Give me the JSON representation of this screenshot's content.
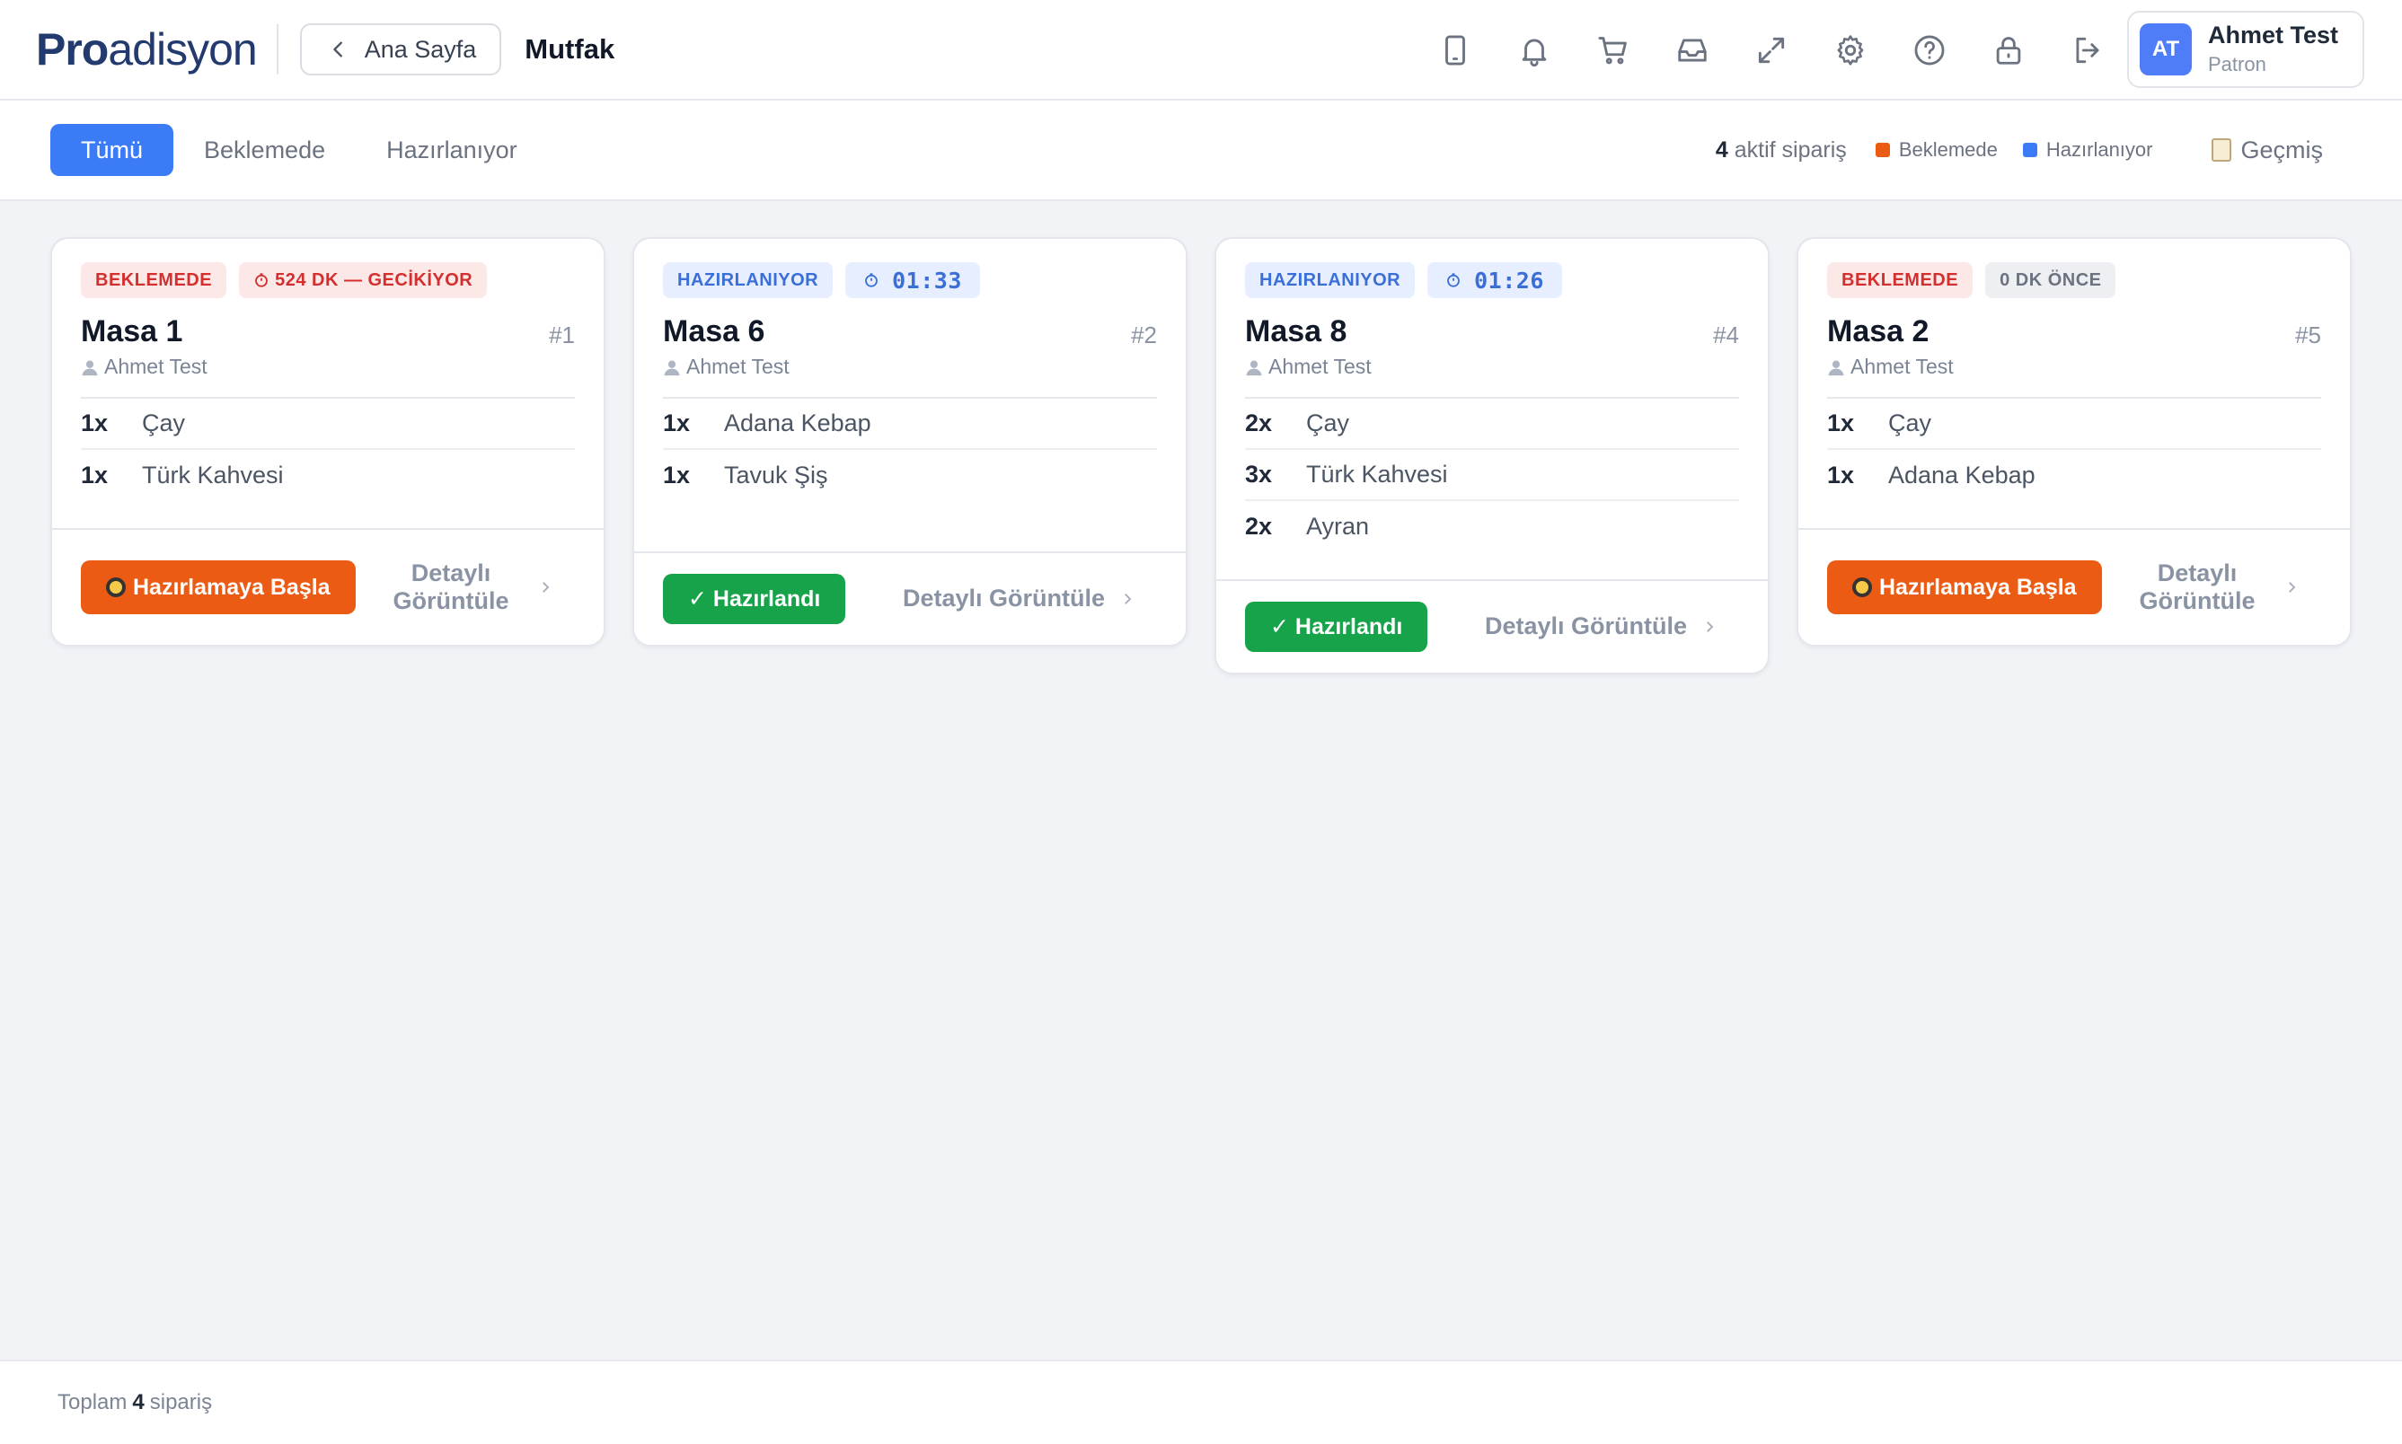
{
  "header": {
    "logo_bold": "Pro",
    "logo_rest": "adisyon",
    "back_label": "Ana Sayfa",
    "page_title": "Mutfak",
    "icons": [
      "tablet-icon",
      "bell-icon",
      "cart-icon",
      "inbox-icon",
      "expand-icon",
      "gear-icon",
      "help-icon",
      "lock-icon",
      "logout-icon"
    ],
    "user": {
      "initials": "AT",
      "name": "Ahmet Test",
      "role": "Patron"
    }
  },
  "filters": {
    "tabs": [
      {
        "label": "Tümü",
        "active": true
      },
      {
        "label": "Beklemede",
        "active": false
      },
      {
        "label": "Hazırlanıyor",
        "active": false
      }
    ],
    "active_count": "4",
    "active_count_label": "aktif sipariş",
    "legend": [
      {
        "label": "Beklemede",
        "color": "#ec5b13"
      },
      {
        "label": "Hazırlanıyor",
        "color": "#3b7cf6"
      }
    ],
    "history_label": "Geçmiş"
  },
  "orders": [
    {
      "status": "BEKLEMEDE",
      "time_badge": "524 DK — GECİKİYOR",
      "table": "Masa 1",
      "number": "#1",
      "waiter": "Ahmet Test",
      "items": [
        {
          "qty": "1x",
          "name": "Çay"
        },
        {
          "qty": "1x",
          "name": "Türk Kahvesi"
        }
      ],
      "action": "Hazırlamaya Başla",
      "detail": "Detaylı Görüntüle"
    },
    {
      "status": "HAZIRLANIYOR",
      "time_badge": "01:33",
      "table": "Masa 6",
      "number": "#2",
      "waiter": "Ahmet Test",
      "items": [
        {
          "qty": "1x",
          "name": "Adana Kebap"
        },
        {
          "qty": "1x",
          "name": "Tavuk Şiş"
        }
      ],
      "action": "✓ Hazırlandı",
      "detail": "Detaylı Görüntüle"
    },
    {
      "status": "HAZIRLANIYOR",
      "time_badge": "01:26",
      "table": "Masa 8",
      "number": "#4",
      "waiter": "Ahmet Test",
      "items": [
        {
          "qty": "2x",
          "name": "Çay"
        },
        {
          "qty": "3x",
          "name": "Türk Kahvesi"
        },
        {
          "qty": "2x",
          "name": "Ayran"
        }
      ],
      "action": "✓ Hazırlandı",
      "detail": "Detaylı Görüntüle"
    },
    {
      "status": "BEKLEMEDE",
      "time_badge": "0 DK ÖNCE",
      "table": "Masa 2",
      "number": "#5",
      "waiter": "Ahmet Test",
      "items": [
        {
          "qty": "1x",
          "name": "Çay"
        },
        {
          "qty": "1x",
          "name": "Adana Kebap"
        }
      ],
      "action": "Hazırlamaya Başla",
      "detail": "Detaylı Görüntüle"
    }
  ],
  "footer": {
    "prefix": "Toplam",
    "count": "4",
    "suffix": "sipariş"
  }
}
